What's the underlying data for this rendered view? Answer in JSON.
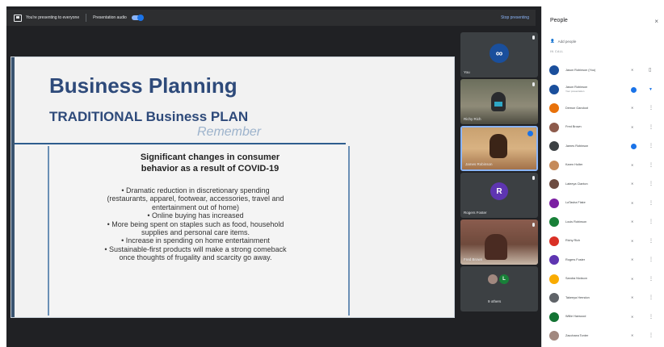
{
  "topbar": {
    "presenting_text": "You're presenting to everyone",
    "audio_label": "Presentation audio",
    "stop_label": "Stop presenting"
  },
  "slide": {
    "title": "Business Planning",
    "subtitle": "TRADITIONAL Business PLAN",
    "remember": "Remember",
    "heading_line1": "Significant changes in consumer",
    "heading_line2": "behavior as a result of COVID-19",
    "bullets": [
      "• Dramatic reduction in discretionary spending",
      "(restaurants, apparel, footwear, accessories, travel and",
      "entertainment out of home)",
      "• Online buying has increased",
      "• More being spent on staples such as food, household",
      "supplies and personal care items.",
      "• Increase in spending on home entertainment",
      "• Sustainable-first products will make a strong  comeback",
      "once thoughts of frugality and scarcity go away."
    ]
  },
  "tiles": [
    {
      "name": "You"
    },
    {
      "name": "Richy Rich"
    },
    {
      "name": "James Robinson"
    },
    {
      "name": "Rogers Foster",
      "initial": "R"
    },
    {
      "name": "Fred Brown"
    },
    {
      "name": "9 others",
      "initial": "L"
    }
  ],
  "panel": {
    "title": "People",
    "close": "×",
    "add_people": "Add people",
    "in_call": "IN CALL",
    "people": [
      {
        "name": "Jason Robinson (You)",
        "color": "#1a4f9c"
      },
      {
        "name": "Jason Robinson",
        "sub": "Your presentation",
        "color": "#1a4f9c"
      },
      {
        "name": "Demun Gandoot",
        "color": "#e8710a"
      },
      {
        "name": "Fred Brown",
        "color": "#8d5b4c"
      },
      {
        "name": "James Robinson",
        "color": "#3c4043"
      },
      {
        "name": "Karen Holter",
        "color": "#c58a5a"
      },
      {
        "name": "Lateeya Clanton",
        "color": "#6d4c41"
      },
      {
        "name": "LaTasha Flake",
        "color": "#7b1fa2"
      },
      {
        "name": "Louis Robinson",
        "color": "#188038"
      },
      {
        "name": "Richy Rich",
        "color": "#d93025"
      },
      {
        "name": "Rogers Foster",
        "color": "#5e35b1"
      },
      {
        "name": "Sandra Nickson",
        "color": "#f9ab00"
      },
      {
        "name": "Takeeya Herndon",
        "color": "#5f6368"
      },
      {
        "name": "Willie Harwood",
        "color": "#137333"
      },
      {
        "name": "Zacchaea Tonter",
        "color": "#a1887f"
      }
    ]
  }
}
